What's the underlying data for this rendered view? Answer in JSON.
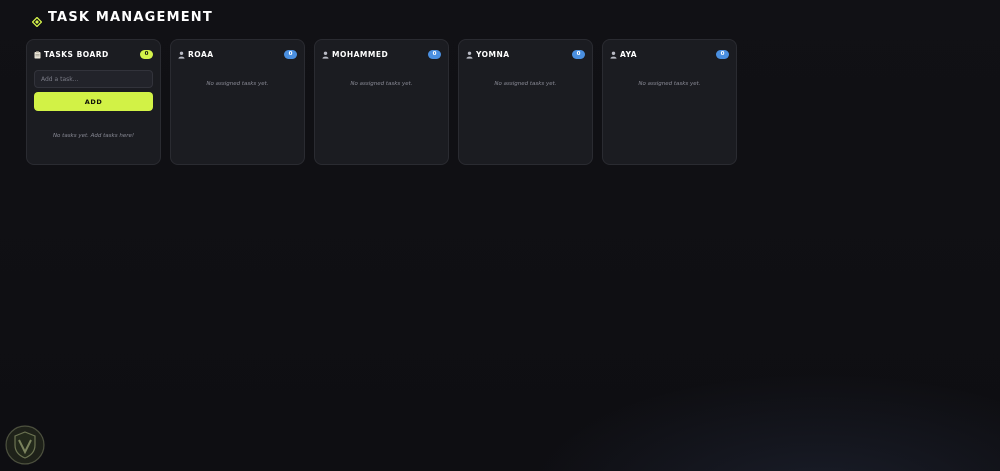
{
  "header": {
    "title": "TASK MANAGEMENT",
    "icon": "diamond-icon",
    "accent_color": "#d4f24a"
  },
  "board_column": {
    "title": "TASKS BOARD",
    "icon": "clipboard-icon",
    "count": "0",
    "input_placeholder": "Add a task...",
    "input_value": "",
    "add_label": "ADD",
    "empty_text": "No tasks yet. Add tasks here!"
  },
  "members": [
    {
      "name": "ROAA",
      "icon": "user-icon",
      "count": "0",
      "empty_text": "No assigned tasks yet."
    },
    {
      "name": "MOHAMMED",
      "icon": "user-icon",
      "count": "0",
      "empty_text": "No assigned tasks yet."
    },
    {
      "name": "YOMNA",
      "icon": "user-icon",
      "count": "0",
      "empty_text": "No assigned tasks yet."
    },
    {
      "name": "AYA",
      "icon": "user-icon",
      "count": "0",
      "empty_text": "No assigned tasks yet."
    }
  ],
  "colors": {
    "background": "#0e0e12",
    "card": "#1b1c21",
    "lime": "#d4f24a",
    "blue_badge": "#4a8fe0"
  },
  "corner_logo": {
    "icon": "shield-logo-icon"
  }
}
